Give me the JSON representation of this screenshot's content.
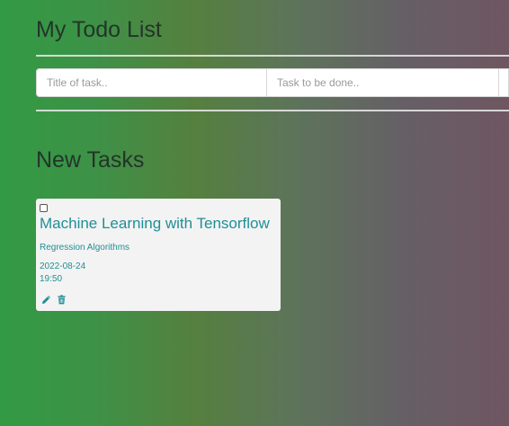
{
  "header": {
    "title": "My Todo List"
  },
  "form": {
    "title_placeholder": "Title of task..",
    "task_placeholder": "Task to be done.."
  },
  "tasks_section": {
    "title": "New Tasks",
    "tasks": [
      {
        "title": "Machine Learning with Tensorflow",
        "description": "Regression Algorithms",
        "date": "2022-08-24",
        "time": "19:50",
        "completed": false
      }
    ]
  },
  "icons": {
    "edit": "pencil-icon",
    "delete": "trash-icon"
  },
  "colors": {
    "accent": "#1f8f96",
    "card_bg": "#f3f3f3",
    "gradient_left": "#329a43",
    "gradient_right": "#6f5661"
  }
}
